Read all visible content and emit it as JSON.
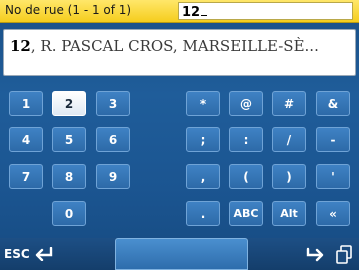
{
  "header": {
    "label": "No de rue  (1 - 1 of 1)",
    "input_value": "12"
  },
  "result": {
    "number": "12",
    "rest": ", R. PASCAL CROS, MARSEILLE-SÈ..."
  },
  "keypad": {
    "keys": [
      {
        "label": "1"
      },
      {
        "label": "2",
        "selected": true
      },
      {
        "label": "3"
      },
      {
        "label": "*"
      },
      {
        "label": "@"
      },
      {
        "label": "#"
      },
      {
        "label": "&"
      },
      {
        "label": "4"
      },
      {
        "label": "5"
      },
      {
        "label": "6"
      },
      {
        "label": ";"
      },
      {
        "label": ":"
      },
      {
        "label": "/"
      },
      {
        "label": "-"
      },
      {
        "label": "7"
      },
      {
        "label": "8"
      },
      {
        "label": "9"
      },
      {
        "label": ","
      },
      {
        "label": "("
      },
      {
        "label": ")"
      },
      {
        "label": "'"
      },
      {
        "label": "0"
      },
      {
        "label": "."
      },
      {
        "label": "ABC"
      },
      {
        "label": "Alt"
      },
      {
        "label": "«"
      }
    ]
  },
  "bottom": {
    "esc_label": "ESC"
  },
  "colors": {
    "background": "#1f5d9a",
    "header": "#f5cd1d",
    "key": "#2d6aa8",
    "key_selected": "#ffffff"
  },
  "icons": {
    "esc": "back-arrow-icon",
    "enter": "enter-arrow-icon",
    "copy": "copy-icon"
  }
}
